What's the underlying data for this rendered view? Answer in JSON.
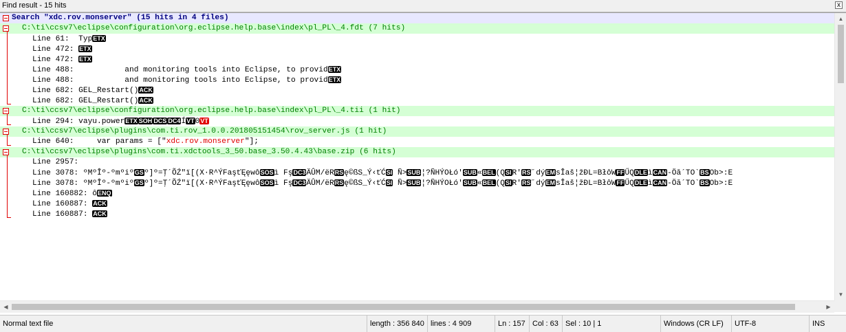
{
  "window": {
    "title": "Find result - 15 hits",
    "close_glyph": "x"
  },
  "results": {
    "header": "Search \"xdc.rov.monserver\" (15 hits in 4 files)",
    "files": [
      {
        "path": "C:\\ti\\ccsv7\\eclipse\\configuration\\org.eclipse.help.base\\index\\pl_PL\\_4.fdt (7 hits)",
        "lines": [
          {
            "prefix": "Line 61:  ",
            "text": "Typ",
            "ctl": [
              "ETX"
            ]
          },
          {
            "prefix": "Line 472: ",
            "text": "",
            "ctl": [
              "ETX"
            ]
          },
          {
            "prefix": "Line 472: ",
            "text": "",
            "ctl": [
              "ETX"
            ]
          },
          {
            "prefix": "Line 488:           ",
            "text": "and monitoring tools into Eclipse, to provid",
            "ctl": [
              "ETX"
            ]
          },
          {
            "prefix": "Line 488:           ",
            "text": "and monitoring tools into Eclipse, to provid",
            "ctl": [
              "ETX"
            ]
          },
          {
            "prefix": "Line 682: ",
            "text": "GEL_Restart()",
            "ctl": [
              "ACK"
            ]
          },
          {
            "prefix": "Line 682: ",
            "text": "GEL_Restart()",
            "ctl": [
              "ACK"
            ]
          }
        ]
      },
      {
        "path": "C:\\ti\\ccsv7\\eclipse\\configuration\\org.eclipse.help.base\\index\\pl_PL\\_4.tii (1 hit)",
        "lines": [
          {
            "prefix": "Line 294: ",
            "text": "vayu.power",
            "ctl": [
              "ETX",
              "SOH",
              "DCS",
              "DC4"
            ],
            "tail": "Í",
            "ctl2": [
              "VT"
            ],
            "tail2": "0",
            "ctl3red": [
              "VT"
            ]
          }
        ]
      },
      {
        "path": "C:\\ti\\ccsv7\\eclipse\\plugins\\com.ti.rov_1.0.0.201805151454\\rov_server.js (1 hit)",
        "lines": [
          {
            "prefix": "Line 640: ",
            "text_before": "    var params = [\"",
            "hit": "xdc.rov.monserver",
            "text_after": "\"];"
          }
        ]
      },
      {
        "path": "C:\\ti\\ccsv7\\eclipse\\plugins\\com.ti.xdctools_3_50.base_3.50.4.43\\base.zip (6 hits)",
        "lines": [
          {
            "prefix": "Line 2957:",
            "text": ""
          },
          {
            "prefix": "Line 3078: ",
            "text": "ºMºÎº-ºmºiº",
            "ctl": [
              "GS"
            ],
            "tail": "º]º=Ţ´ÕŹ\"ï[(X·R^ÝFaşťĘęwô",
            "ctl2": [
              "SOS"
            ],
            "tail2": "ì Fş",
            "ctl3": [
              "DC3"
            ],
            "tail3": "ÄÛM/ëR",
            "ctl4": [
              "RS"
            ],
            "tail4": "ę©ßS_Ý‹ťĆ",
            "ctl5": [
              "SI"
            ],
            "tail5": " Ñ>",
            "ctl6": [
              "SUB"
            ],
            "tail6": "¦?ÑHÝOŁó'",
            "ctl7": [
              "SUB"
            ],
            "tail7": "«",
            "ctl8": [
              "BEL"
            ],
            "tail8": "(Q",
            "ctl9": [
              "SI"
            ],
            "tail9": "R'",
            "ctl10": [
              "RS"
            ],
            "tail10": "˝dý",
            "ctl11": [
              "EM"
            ],
            "tail11": "sÎaš¦žĐL=BłôW",
            "ctl12": [
              "FF"
            ],
            "tail12": "ŰQ",
            "ctl13": [
              "DLE"
            ],
            "tail13": "ì",
            "ctl14": [
              "CAN"
            ],
            "tail14": "-Öă´TO`",
            "ctl15": [
              "BS"
            ],
            "tail15": "Ob>:E"
          },
          {
            "prefix": "Line 3078: ",
            "text": "ºMºÎº-ºmºiº",
            "ctl": [
              "GS"
            ],
            "tail": "º]º=Ţ´ÕŹ\"ï[(X·R^ÝFaşťĘęwô",
            "ctl2": [
              "SOS"
            ],
            "tail2": "ì Fş",
            "ctl3": [
              "DC3"
            ],
            "tail3": "ÄÛM/ëR",
            "ctl4": [
              "RS"
            ],
            "tail4": "ę©ßS_Ý‹ťĆ",
            "ctl5": [
              "SI"
            ],
            "tail5": " Ñ>",
            "ctl6": [
              "SUB"
            ],
            "tail6": "¦?ÑHÝOŁó'",
            "ctl7": [
              "SUB"
            ],
            "tail7": "«",
            "ctl8": [
              "BEL"
            ],
            "tail8": "(Q",
            "ctl9": [
              "SI"
            ],
            "tail9": "R'",
            "ctl10": [
              "RS"
            ],
            "tail10": "˝dý",
            "ctl11": [
              "EM"
            ],
            "tail11": "sÎaš¦žĐL=BłôW",
            "ctl12": [
              "FF"
            ],
            "tail12": "ŰQ",
            "ctl13": [
              "DLE"
            ],
            "tail13": "ì",
            "ctl14": [
              "CAN"
            ],
            "tail14": "-Öă´TO`",
            "ctl15": [
              "BS"
            ],
            "tail15": "Ob>:E"
          },
          {
            "prefix": "Line 160882: ",
            "text": "ô",
            "ctl": [
              "ENQ"
            ]
          },
          {
            "prefix": "Line 160887: ",
            "text": "",
            "ctl": [
              "ACK"
            ]
          },
          {
            "prefix": "Line 160887: ",
            "text": "",
            "ctl": [
              "ACK"
            ]
          }
        ]
      }
    ]
  },
  "status": {
    "file_type": "Normal text file",
    "length": "length : 356 840",
    "lines": "lines : 4 909",
    "ln": "Ln : 157",
    "col": "Col : 63",
    "sel": "Sel : 10 | 1",
    "eol": "Windows (CR LF)",
    "encoding": "UTF-8",
    "mode": "INS"
  }
}
